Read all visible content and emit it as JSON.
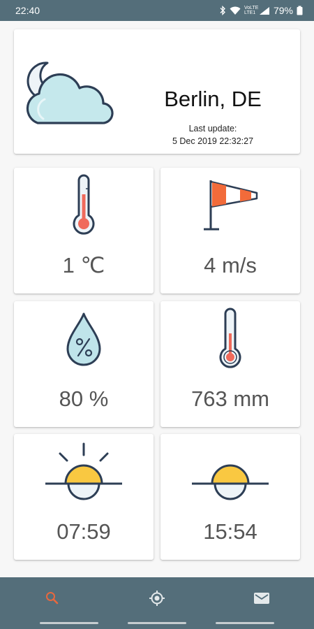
{
  "status_bar": {
    "time": "22:40",
    "network": "VoLTE LTE1",
    "battery": "79%"
  },
  "city_card": {
    "weather_icon": "night-cloud-icon",
    "city": "Berlin, DE",
    "last_update_label": "Last update:",
    "last_update_value": "5 Dec 2019 22:32:27"
  },
  "tiles": {
    "temperature": {
      "icon": "thermometer-icon",
      "value": "1 ℃"
    },
    "wind": {
      "icon": "windsock-icon",
      "value": "4 m/s"
    },
    "humidity": {
      "icon": "humidity-drop-icon",
      "value": "80 %"
    },
    "pressure": {
      "icon": "barometer-icon",
      "value": "763 mm"
    },
    "sunrise": {
      "icon": "sunrise-icon",
      "value": "07:59"
    },
    "sunset": {
      "icon": "sunset-icon",
      "value": "15:54"
    }
  },
  "bottom_nav": {
    "items": [
      {
        "name": "search",
        "icon": "search-icon",
        "active": true
      },
      {
        "name": "location",
        "icon": "location-icon",
        "active": false
      },
      {
        "name": "mail",
        "icon": "mail-icon",
        "active": false
      }
    ]
  },
  "colors": {
    "primary": "#546e7a",
    "active_nav": "#e8683e",
    "inactive_nav": "#e4e9eb",
    "sun": "#f9c841",
    "windsock": "#f26b3a",
    "outline": "#2d3e55"
  }
}
